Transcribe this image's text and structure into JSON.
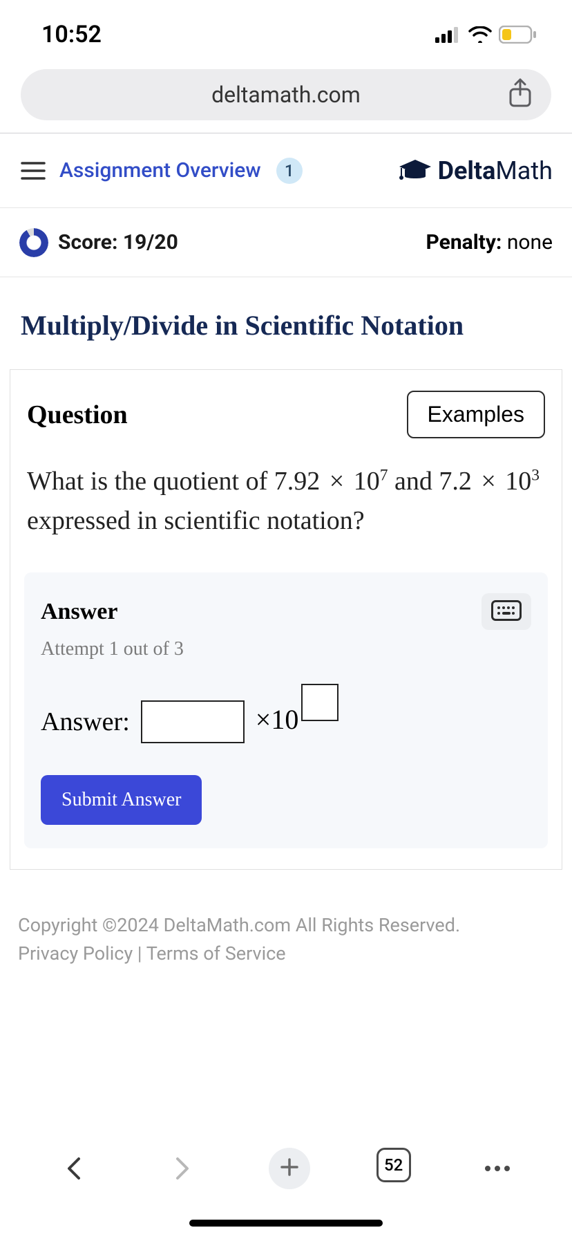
{
  "status": {
    "time": "10:52"
  },
  "browser": {
    "url": "deltamath.com",
    "tab_count": "52"
  },
  "header": {
    "overview_label": "Assignment Overview",
    "overview_badge": "1",
    "brand_delta": "Delta",
    "brand_math": "Math"
  },
  "score": {
    "label": "Score: 19/20",
    "penalty_label": "Penalty: ",
    "penalty_value": "none"
  },
  "topic": {
    "title": "Multiply/Divide in Scientific Notation"
  },
  "question": {
    "header": "Question",
    "examples_btn": "Examples",
    "prefix": "What is the quotient of ",
    "num1_coef": "7.92",
    "num1_base": "10",
    "num1_exp": "7",
    "middle": " and ",
    "num2_coef": "7.2",
    "num2_base": "10",
    "num2_exp": "3",
    "suffix": " expressed in scientific notation?"
  },
  "answer": {
    "title": "Answer",
    "attempt": "Attempt 1 out of 3",
    "label": "Answer:",
    "times_ten": "×10",
    "submit": "Submit Answer"
  },
  "footer": {
    "copyright": "Copyright ©2024 DeltaMath.com All Rights Reserved.",
    "privacy": "Privacy Policy",
    "sep": " | ",
    "terms": "Terms of Service"
  }
}
